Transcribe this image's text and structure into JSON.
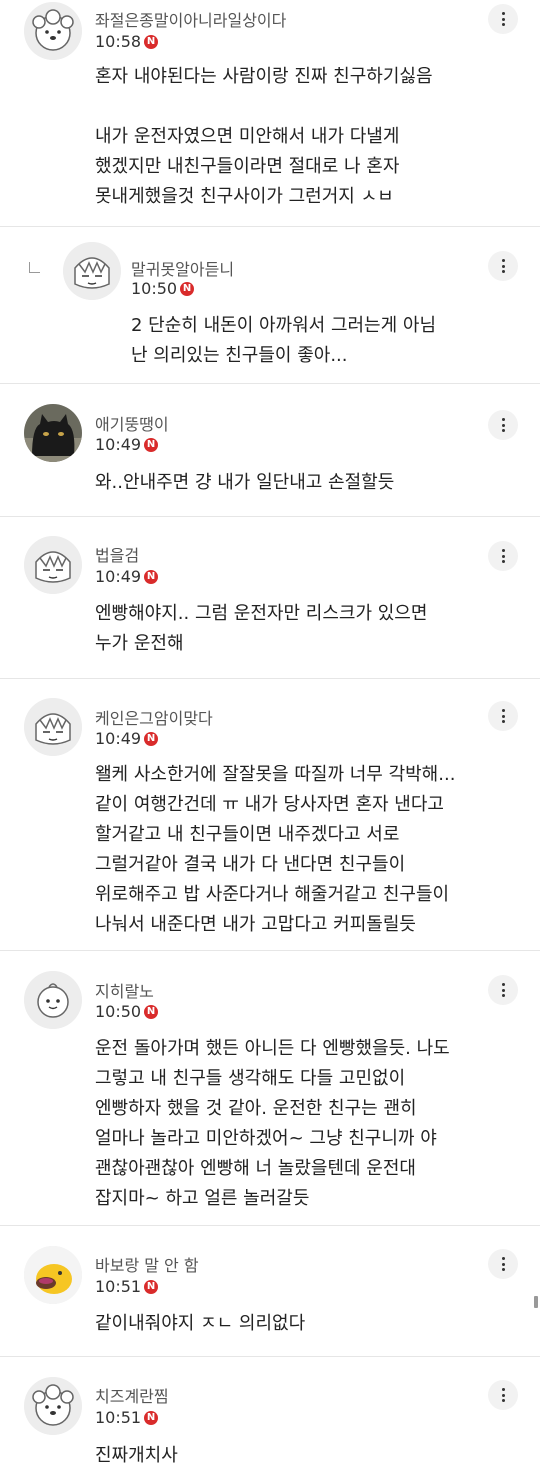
{
  "comments": [
    {
      "nickname": "좌절은종말이아니라일상이다",
      "time": "10:58",
      "badge": "N",
      "avatar": "white-dog-icon",
      "text": "혼자 내야된다는 사람이랑 진짜 친구하기싫음\n\n내가 운전자였으면 미안해서 내가 다낼게\n했겠지만 내친구들이라면 절대로 나 혼자\n못내게했을것 친구사이가 그런거지 ㅅㅂ"
    },
    {
      "nickname": "말귀못알아듣니",
      "time": "10:50",
      "badge": "N",
      "avatar": "sleepy-face-icon",
      "text": "2 단순히 내돈이 아까워서 그러는게 아님\n난 의리있는 친구들이 좋아..."
    },
    {
      "nickname": "애기뚱땡이",
      "time": "10:49",
      "badge": "N",
      "avatar": "black-cat-photo",
      "text": "와..안내주면 걍 내가 일단내고 손절할듯"
    },
    {
      "nickname": "법을검",
      "time": "10:49",
      "badge": "N",
      "avatar": "sleepy-face-icon",
      "text": "엔빵해야지.. 그럼 운전자만 리스크가 있으면\n누가 운전해"
    },
    {
      "nickname": "케인은그암이맞다",
      "time": "10:49",
      "badge": "N",
      "avatar": "sleepy-face-icon",
      "text": "왤케 사소한거에 잘잘못을 따질까 너무 각박해...\n같이 여행간건데 ㅠ 내가 당사자면 혼자 낸다고\n할거같고 내 친구들이면 내주겠다고 서로\n그럴거같아 결국 내가 다 낸다면 친구들이\n위로해주고 밥 사준다거나 해줄거같고 친구들이\n나눠서 내준다면 내가 고맙다고 커피돌릴듯"
    },
    {
      "nickname": "지히랄노",
      "time": "10:50",
      "badge": "N",
      "avatar": "smile-face-icon",
      "text": "운전 돌아가며 했든 아니든 다 엔빵했을듯. 나도\n그렇고 내 친구들 생각해도 다들 고민없이\n엔빵하자 했을 것 같아. 운전한 친구는 괜히\n얼마나 놀라고 미안하겠어~ 그냥 친구니까 야\n괜찮아괜찮아 엔빵해 너 놀랐을텐데 운전대\n잡지마~ 하고 얼른 놀러갈듯"
    },
    {
      "nickname": "바보랑 말 안 함",
      "time": "10:51",
      "badge": "N",
      "avatar": "yellow-duck-icon",
      "text": "같이내줘야지 ㅈㄴ 의리없다"
    },
    {
      "nickname": "치즈계란찜",
      "time": "10:51",
      "badge": "N",
      "avatar": "white-dog-icon",
      "text": "진짜개치사"
    }
  ],
  "colors": {
    "badge": "#d92b2b",
    "divider": "#e6e6e6"
  }
}
